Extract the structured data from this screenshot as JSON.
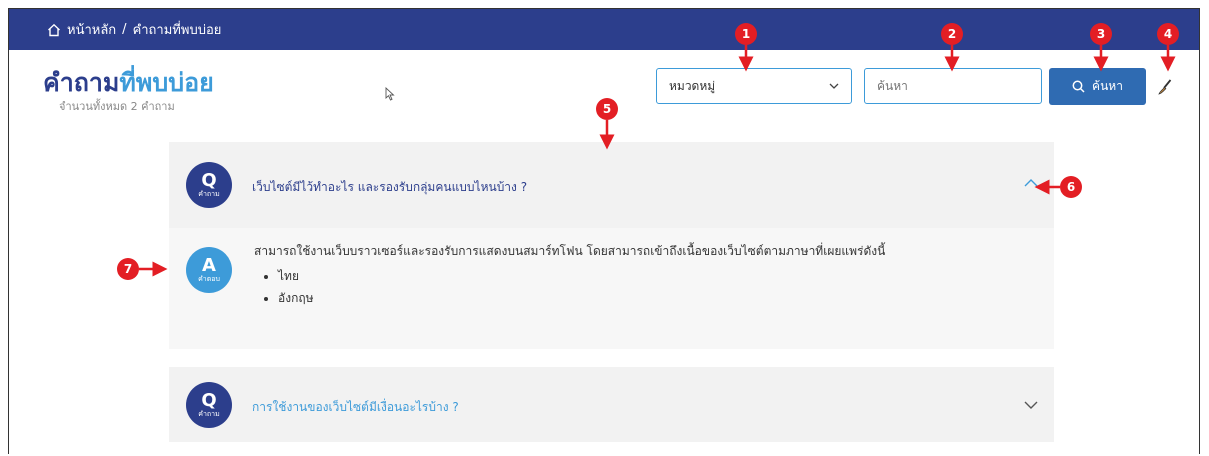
{
  "breadcrumb": {
    "home": "หน้าหลัก",
    "separator": "/",
    "current": "คำถามที่พบบ่อย"
  },
  "page": {
    "title_main": "คำถาม",
    "title_highlight": "ที่พบบ่อย",
    "subtitle": "จำนวนทั้งหมด 2 คำถาม"
  },
  "filters": {
    "category_selected": "หมวดหมู่",
    "search_placeholder": "ค้นหา",
    "search_button": "ค้นหา"
  },
  "faq": [
    {
      "badge": "Q",
      "badge_label": "คำถาม",
      "question": "เว็บไซต์มีไว้ทำอะไร และรองรับกลุ่มคนแบบไหนบ้าง ?",
      "expanded": true,
      "answer_badge": "A",
      "answer_badge_label": "คำตอบ",
      "answer": "สามารถใช้งานเว็บบราวเซอร์และรองรับการแสดงบนสมาร์ทโฟน โดยสามารถเข้าถึงเนื้อของเว็บไซต์ตามภาษาที่เผยแพร่ดังนี้",
      "answer_items": [
        "ไทย",
        "อังกฤษ"
      ]
    },
    {
      "badge": "Q",
      "badge_label": "คำถาม",
      "question": "การใช้งานของเว็บไซต์มีเงื่อนอะไรบ้าง ?",
      "expanded": false
    }
  ],
  "annotations": [
    "1",
    "2",
    "3",
    "4",
    "5",
    "6",
    "7"
  ],
  "colors": {
    "navy": "#2c3e8c",
    "accent": "#3d9bd9",
    "button": "#2f6bb2",
    "marker": "#e31e24"
  },
  "icons": {
    "home": "home-icon",
    "search": "search-icon",
    "clear": "brush-icon",
    "dropdown": "chevron-down-icon",
    "collapse": "chevron-up-icon",
    "expand": "chevron-down-icon"
  }
}
